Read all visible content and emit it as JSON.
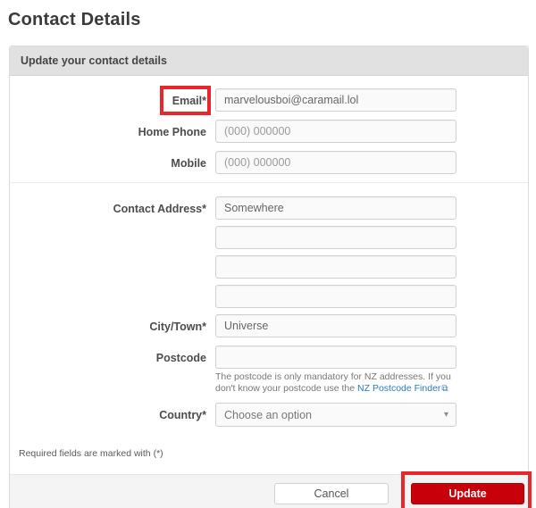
{
  "page": {
    "title": "Contact Details"
  },
  "panel": {
    "header": "Update your contact details"
  },
  "fields": {
    "email": {
      "label": "Email*",
      "value": "marvelousboi@caramail.lol"
    },
    "home_phone": {
      "label": "Home Phone",
      "placeholder": "(000) 000000"
    },
    "mobile": {
      "label": "Mobile",
      "placeholder": "(000) 000000"
    },
    "contact_address": {
      "label": "Contact Address*",
      "value": "Somewhere"
    },
    "city_town": {
      "label": "City/Town*",
      "value": "Universe"
    },
    "postcode": {
      "label": "Postcode",
      "value": "",
      "help_text_before": "The postcode is only mandatory for NZ addresses. If you don't know your postcode use the ",
      "help_link_text": "NZ Postcode Finder"
    },
    "country": {
      "label": "Country*",
      "selected_option": "Choose an option"
    }
  },
  "notes": {
    "required": "Required fields are marked with (*)"
  },
  "footer": {
    "cancel_label": "Cancel",
    "update_label": "Update"
  },
  "icons": {
    "external_link": "⧉",
    "select_caret": "▾"
  },
  "colors": {
    "annotation_red": "#e8262b",
    "button_red": "#c8000a",
    "link_blue": "#2b7abc",
    "panel_header_bg": "#e1e1e1",
    "footer_bg": "#f4f4f4"
  }
}
